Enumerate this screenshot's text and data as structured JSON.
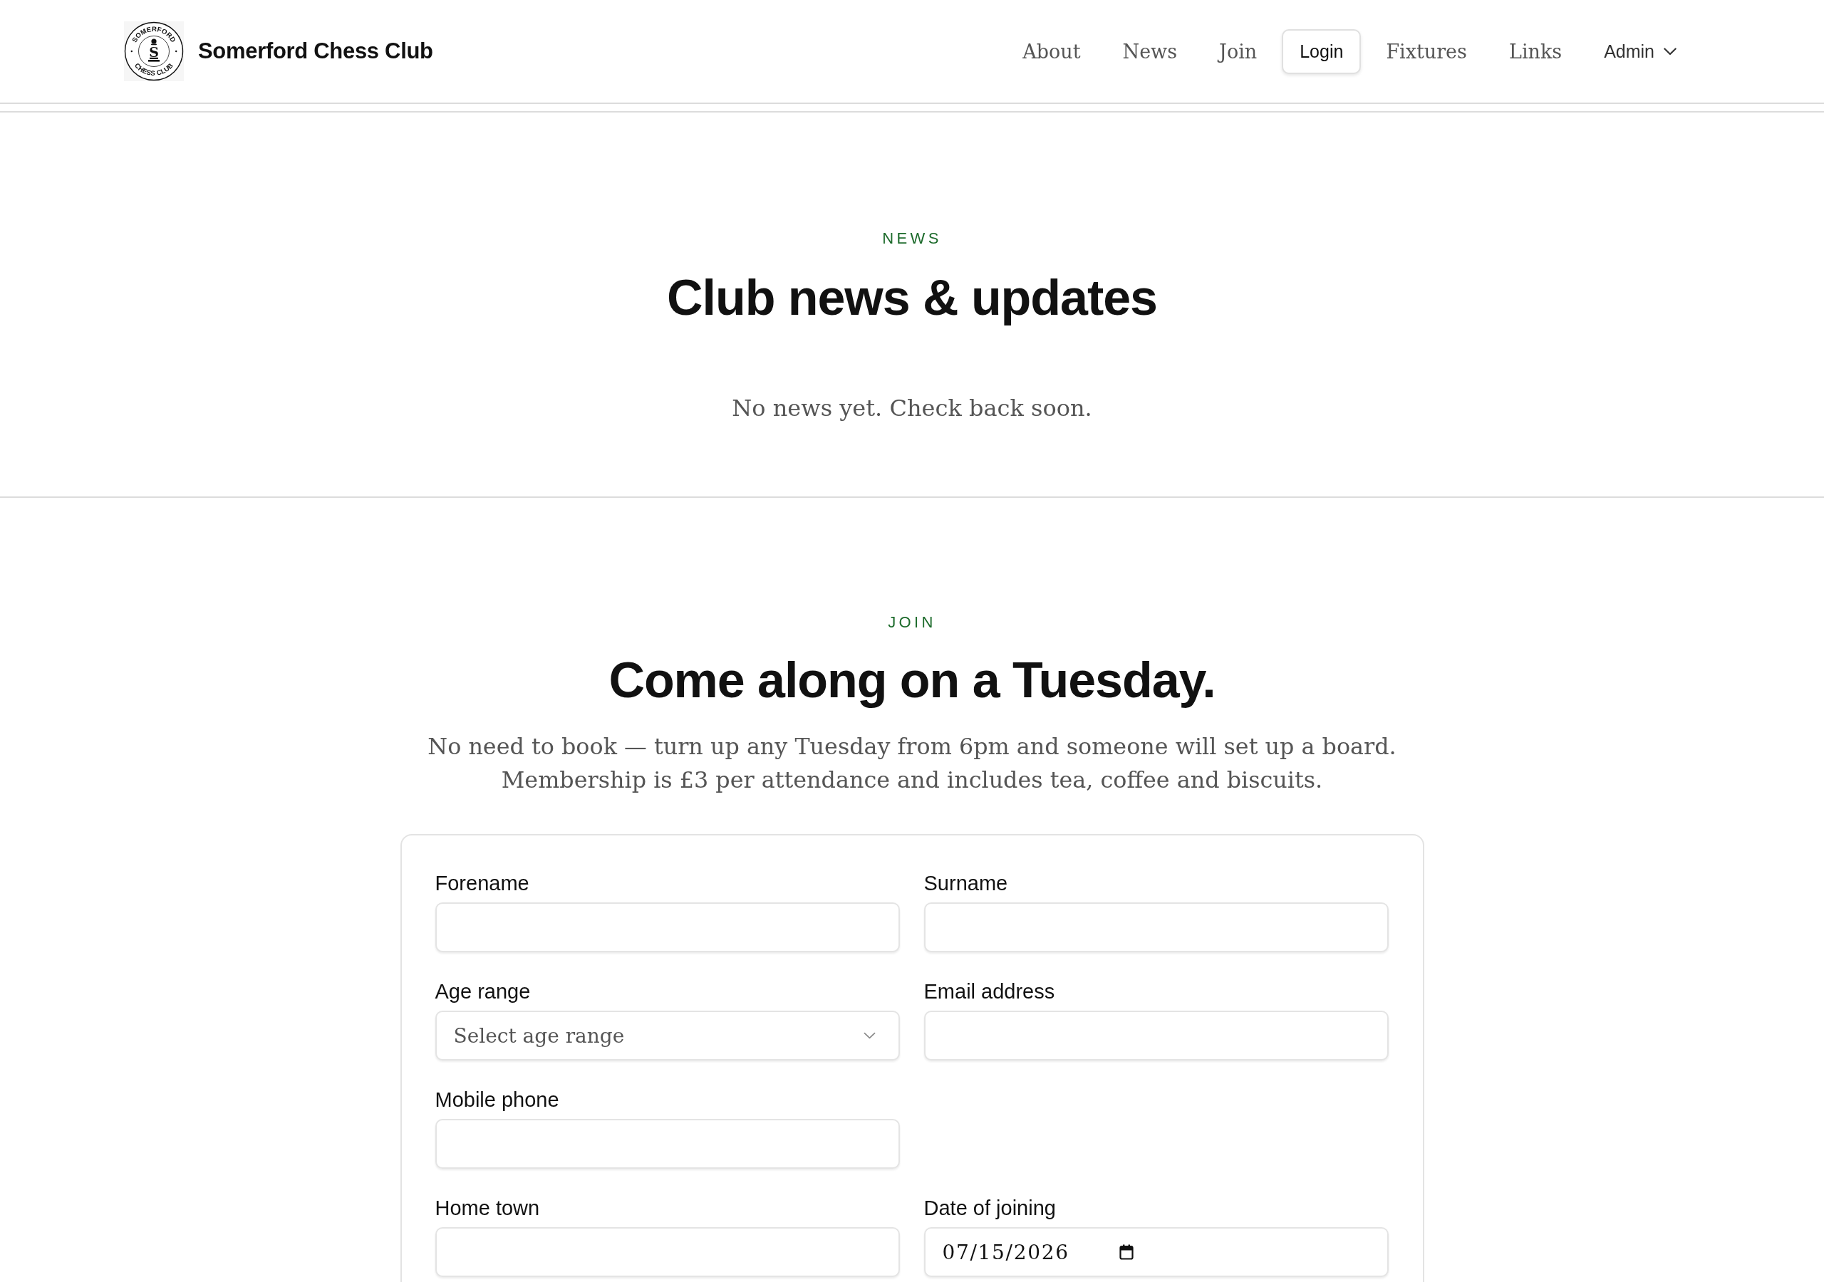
{
  "header": {
    "logo": {
      "ring_top": "SOMERFORD",
      "ring_bottom": "CHESS CLUB",
      "monogram": "S"
    },
    "title": "Somerford Chess Club",
    "nav": [
      {
        "label": "About",
        "kind": "link"
      },
      {
        "label": "News",
        "kind": "link"
      },
      {
        "label": "Join",
        "kind": "link"
      },
      {
        "label": "Login",
        "kind": "button"
      },
      {
        "label": "Fixtures",
        "kind": "link"
      },
      {
        "label": "Links",
        "kind": "link"
      },
      {
        "label": "Admin",
        "kind": "menu"
      }
    ]
  },
  "news": {
    "eyebrow": "NEWS",
    "title": "Club news & updates",
    "empty_message": "No news yet. Check back soon."
  },
  "join": {
    "eyebrow": "JOIN",
    "title": "Come along on a Tuesday.",
    "intro": [
      "No need to book — turn up any Tuesday from 6pm and someone will set up a board.",
      "Membership is £3 per attendance and includes tea, coffee and biscuits."
    ],
    "form": {
      "rows": [
        {
          "fields": [
            {
              "label": "Forename",
              "kind": "text"
            },
            {
              "label": "Surname",
              "kind": "text"
            }
          ]
        },
        {
          "fields": [
            {
              "label": "Age range",
              "kind": "select",
              "placeholder": "Select age range"
            },
            {
              "label": "Email address",
              "kind": "text"
            }
          ]
        },
        {
          "fields": [
            {
              "label": "Mobile phone",
              "kind": "text"
            }
          ]
        },
        {
          "fields": [
            {
              "label": "Home town",
              "kind": "text"
            },
            {
              "label": "Date of joining",
              "kind": "date",
              "value": "07/15/2026"
            }
          ]
        }
      ]
    }
  }
}
